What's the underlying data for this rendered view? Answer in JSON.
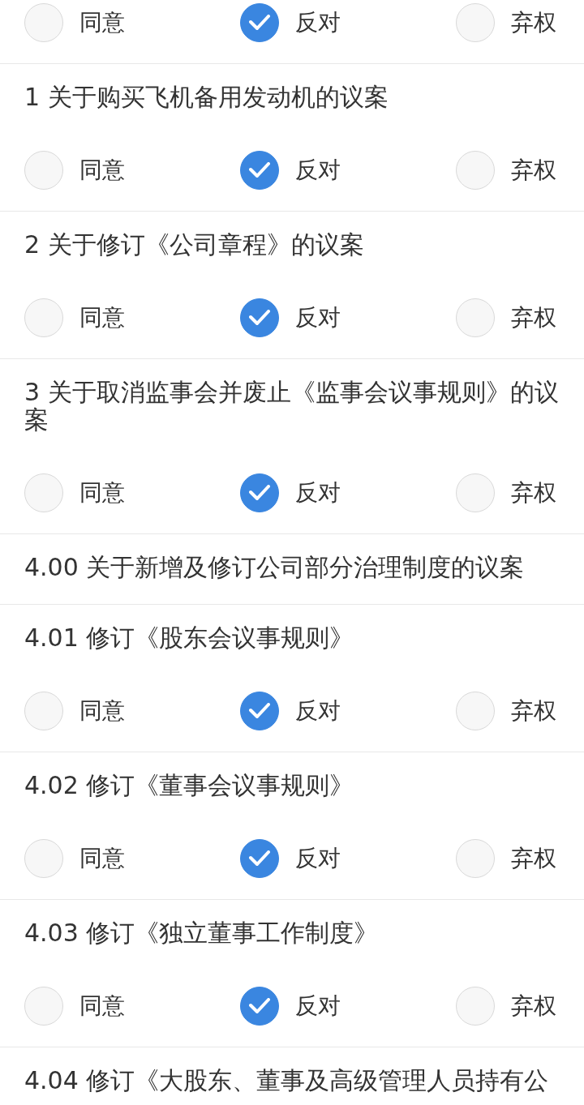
{
  "items": [
    {
      "kind": "vote",
      "options": [
        {
          "label": "同意",
          "selected": false
        },
        {
          "label": "反对",
          "selected": true
        },
        {
          "label": "弃权",
          "selected": false
        }
      ]
    },
    {
      "kind": "vote",
      "title": "1 关于购买飞机备用发动机的议案",
      "options": [
        {
          "label": "同意",
          "selected": false
        },
        {
          "label": "反对",
          "selected": true
        },
        {
          "label": "弃权",
          "selected": false
        }
      ]
    },
    {
      "kind": "vote",
      "title": "2 关于修订《公司章程》的议案",
      "options": [
        {
          "label": "同意",
          "selected": false
        },
        {
          "label": "反对",
          "selected": true
        },
        {
          "label": "弃权",
          "selected": false
        }
      ]
    },
    {
      "kind": "vote",
      "title": "3 关于取消监事会并废止《监事会议事规则》的议案",
      "options": [
        {
          "label": "同意",
          "selected": false
        },
        {
          "label": "反对",
          "selected": true
        },
        {
          "label": "弃权",
          "selected": false
        }
      ]
    },
    {
      "kind": "heading",
      "title": "4.00 关于新增及修订公司部分治理制度的议案"
    },
    {
      "kind": "vote",
      "title": "4.01 修订《股东会议事规则》",
      "options": [
        {
          "label": "同意",
          "selected": false
        },
        {
          "label": "反对",
          "selected": true
        },
        {
          "label": "弃权",
          "selected": false
        }
      ]
    },
    {
      "kind": "vote",
      "title": "4.02 修订《董事会议事规则》",
      "options": [
        {
          "label": "同意",
          "selected": false
        },
        {
          "label": "反对",
          "selected": true
        },
        {
          "label": "弃权",
          "selected": false
        }
      ]
    },
    {
      "kind": "vote",
      "title": "4.03 修订《独立董事工作制度》",
      "options": [
        {
          "label": "同意",
          "selected": false
        },
        {
          "label": "反对",
          "selected": true
        },
        {
          "label": "弃权",
          "selected": false
        }
      ]
    },
    {
      "kind": "heading",
      "title": "4.04 修订《大股东、董事及高级管理人员持有公"
    }
  ]
}
